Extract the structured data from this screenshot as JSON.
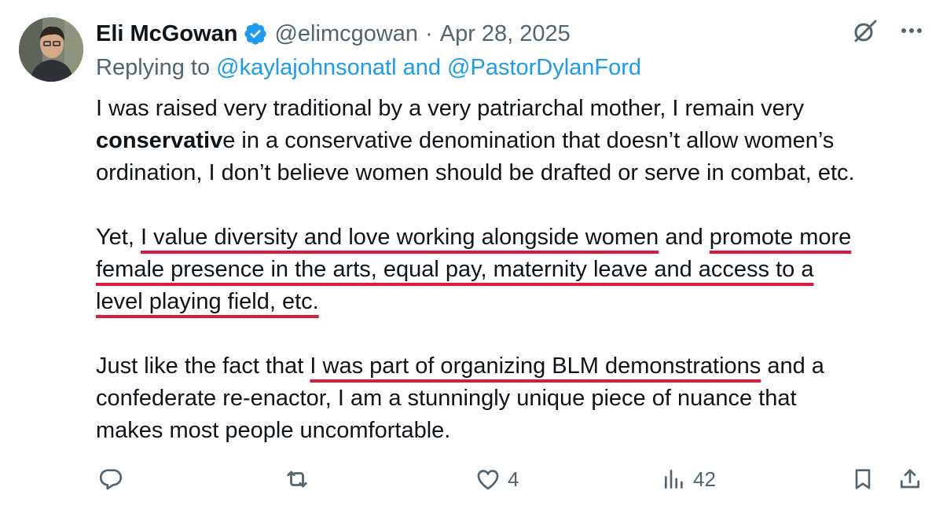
{
  "tweet": {
    "author": {
      "display_name": "Eli McGowan",
      "handle": "@elimcgowan",
      "separator": "·",
      "date": "Apr 28, 2025"
    },
    "reply": {
      "prefix": "Replying to",
      "mention1": "@kaylajohnsonatl",
      "conjunction": "and",
      "mention2": "@PastorDylanFord"
    },
    "body": {
      "p1": {
        "l1": "I was raised very traditional by a very patriarchal mother, I remain very",
        "l2_bold": "conservativ",
        "l2_rest": "e in a conservative denomination that doesn’t allow women’s",
        "l3": "ordination, I don’t believe women should be drafted or serve in combat, etc."
      },
      "p2": {
        "l1_a": "Yet, ",
        "l1_u1": "I value diversity and love working alongside women",
        "l1_b": " and ",
        "l1_u2": "promote more",
        "l2_u": "female presence in the arts, equal pay, maternity leave and access to a",
        "l3_u": "level playing field, etc."
      },
      "p3": {
        "l1_a": "Just like the fact that ",
        "l1_u": "I was part of organizing BLM demonstrations",
        "l1_b": " and a",
        "l2": "confederate re-enactor, I am a stunningly unique piece of nuance that",
        "l3": "makes most people uncomfortable."
      }
    },
    "actions": {
      "like_count": "4",
      "views_count": "42"
    },
    "icons": {
      "verified": "verified-badge-icon",
      "grok": "grok-icon",
      "more": "more-icon",
      "reply": "reply-icon",
      "retweet": "retweet-icon",
      "like": "heart-icon",
      "views": "views-icon",
      "bookmark": "bookmark-icon",
      "share": "share-icon"
    },
    "colors": {
      "verified_blue": "#1d9bf0",
      "mention_blue": "#1d9bf0",
      "underline_red": "#e0173f",
      "secondary_text": "#536471"
    }
  }
}
